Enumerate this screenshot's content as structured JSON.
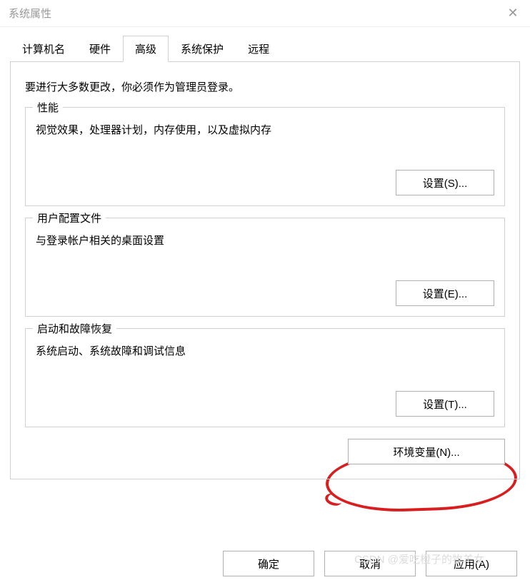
{
  "window": {
    "title": "系统属性"
  },
  "tabs": {
    "computer_name": "计算机名",
    "hardware": "硬件",
    "advanced": "高级",
    "protection": "系统保护",
    "remote": "远程"
  },
  "intro": "要进行大多数更改，你必须作为管理员登录。",
  "performance": {
    "title": "性能",
    "desc": "视觉效果，处理器计划，内存使用，以及虚拟内存",
    "button": "设置(S)..."
  },
  "user_profiles": {
    "title": "用户配置文件",
    "desc": "与登录帐户相关的桌面设置",
    "button": "设置(E)..."
  },
  "startup": {
    "title": "启动和故障恢复",
    "desc": "系统启动、系统故障和调试信息",
    "button": "设置(T)..."
  },
  "env_button": "环境变量(N)...",
  "footer": {
    "ok": "确定",
    "cancel": "取消",
    "apply": "应用(A)"
  },
  "watermark": "CSDN @爱吃橙子的牧羊女"
}
